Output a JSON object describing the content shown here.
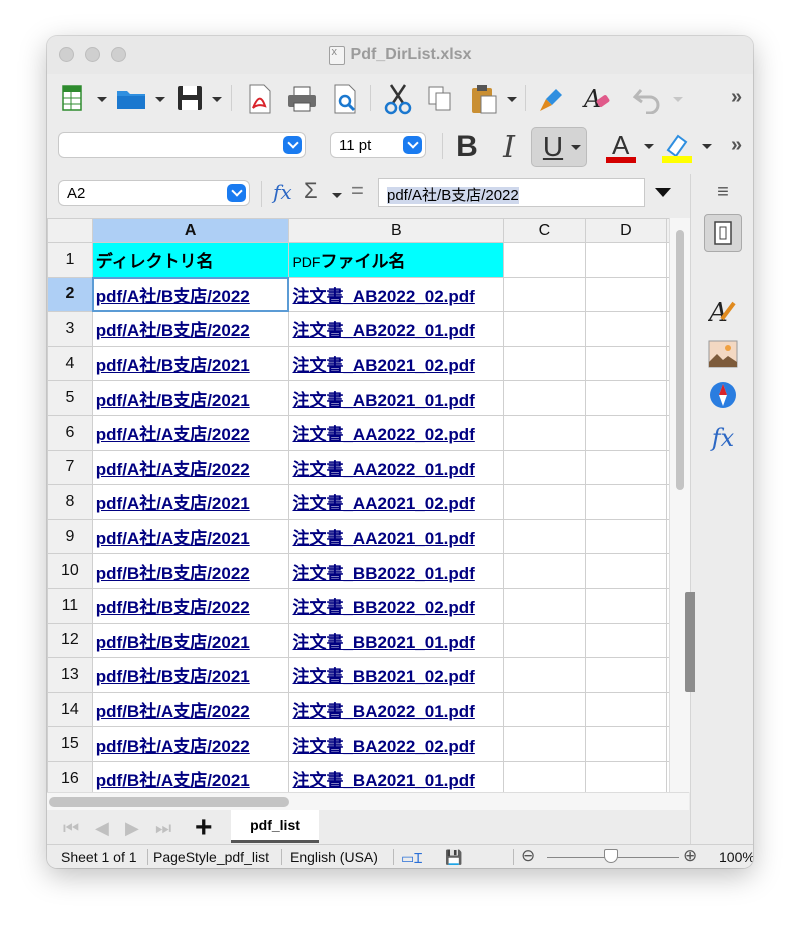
{
  "window": {
    "title": "Pdf_DirList.xlsx"
  },
  "font": {
    "name": "",
    "size": "11 pt"
  },
  "name_box": "A2",
  "formula": "pdf/A社/B支店/2022",
  "columns": [
    "A",
    "B",
    "C",
    "D"
  ],
  "rows": [
    {
      "n": "1",
      "a": "ディレクトリ名",
      "b_prefix": "PDF",
      "b": "ファイル名"
    },
    {
      "n": "2",
      "a": "pdf/A社/B支店/2022",
      "b": "注文書_AB2022_02.pdf"
    },
    {
      "n": "3",
      "a": "pdf/A社/B支店/2022",
      "b": "注文書_AB2022_01.pdf"
    },
    {
      "n": "4",
      "a": "pdf/A社/B支店/2021",
      "b": "注文書_AB2021_02.pdf"
    },
    {
      "n": "5",
      "a": "pdf/A社/B支店/2021",
      "b": "注文書_AB2021_01.pdf"
    },
    {
      "n": "6",
      "a": "pdf/A社/A支店/2022",
      "b": "注文書_AA2022_02.pdf"
    },
    {
      "n": "7",
      "a": "pdf/A社/A支店/2022",
      "b": "注文書_AA2022_01.pdf"
    },
    {
      "n": "8",
      "a": "pdf/A社/A支店/2021",
      "b": "注文書_AA2021_02.pdf"
    },
    {
      "n": "9",
      "a": "pdf/A社/A支店/2021",
      "b": "注文書_AA2021_01.pdf"
    },
    {
      "n": "10",
      "a": "pdf/B社/B支店/2022",
      "b": "注文書_BB2022_01.pdf"
    },
    {
      "n": "11",
      "a": "pdf/B社/B支店/2022",
      "b": "注文書_BB2022_02.pdf"
    },
    {
      "n": "12",
      "a": "pdf/B社/B支店/2021",
      "b": "注文書_BB2021_01.pdf"
    },
    {
      "n": "13",
      "a": "pdf/B社/B支店/2021",
      "b": "注文書_BB2021_02.pdf"
    },
    {
      "n": "14",
      "a": "pdf/B社/A支店/2022",
      "b": "注文書_BA2022_01.pdf"
    },
    {
      "n": "15",
      "a": "pdf/B社/A支店/2022",
      "b": "注文書_BA2022_02.pdf"
    },
    {
      "n": "16",
      "a": "pdf/B社/A支店/2021",
      "b": "注文書_BA2021_01.pdf"
    }
  ],
  "sheet_tab": "pdf_list",
  "status": {
    "sheet": "Sheet 1 of 1",
    "page_style": "PageStyle_pdf_list",
    "language": "English (USA)",
    "zoom": "100%"
  },
  "colors": {
    "header_fill": "#00ffff",
    "link": "#000080",
    "selection": "#aecff5",
    "accent": "#1a7bf0"
  }
}
